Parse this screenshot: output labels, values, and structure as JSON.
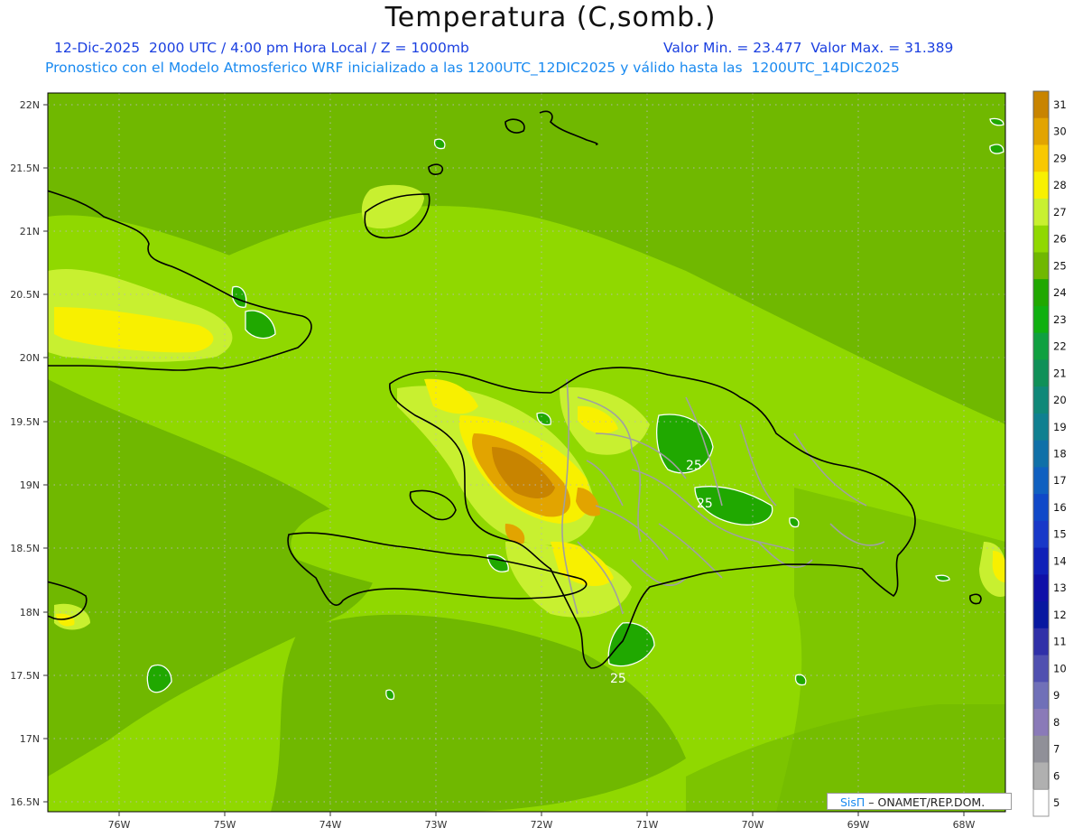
{
  "header": {
    "title": "Temperatura (C,somb.)",
    "valid_line": "12-Dic-2025  2000 UTC / 4:00 pm Hora Local / Z = 1000mb",
    "minmax_line": "Valor Min. = 23.477  Valor Max. = 31.389",
    "model_line": "Pronostico con el Modelo Atmosferico WRF inicializado a las 1200UTC_12DIC2025 y válido hasta las  1200UTC_14DIC2025"
  },
  "map": {
    "lat_labels": [
      "22N",
      "21.5N",
      "21N",
      "20.5N",
      "20N",
      "19.5N",
      "19N",
      "18.5N",
      "18N",
      "17.5N",
      "17N",
      "16.5N"
    ],
    "lon_labels": [
      "76W",
      "75W",
      "74W",
      "73W",
      "72W",
      "71W",
      "70W",
      "69W",
      "68W"
    ],
    "contour_labels": [
      "25",
      "25",
      "25"
    ]
  },
  "colorbar": {
    "levels": [
      "31",
      "30",
      "29",
      "28",
      "27",
      "26",
      "25",
      "24",
      "23",
      "22",
      "21",
      "20",
      "19",
      "18",
      "17",
      "16",
      "15",
      "14",
      "13",
      "12",
      "11",
      "10",
      "9",
      "8",
      "7",
      "6",
      "5"
    ],
    "colors": [
      "#c88400",
      "#e2a400",
      "#f8c800",
      "#f8f000",
      "#c8f030",
      "#90d800",
      "#70b800",
      "#20a800",
      "#10b010",
      "#10a040",
      "#109058",
      "#108878",
      "#108090",
      "#1070a8",
      "#1060c0",
      "#1048c8",
      "#1838c8",
      "#1020b8",
      "#1010a8",
      "#0818a0",
      "#3030a8",
      "#5050b0",
      "#7070b8",
      "#8a7ab8",
      "#909098",
      "#b0b0b0",
      "#d8d8d8"
    ]
  },
  "credit": {
    "brand": "SisΠ",
    "org": " – ONAMET/REP.DOM."
  }
}
